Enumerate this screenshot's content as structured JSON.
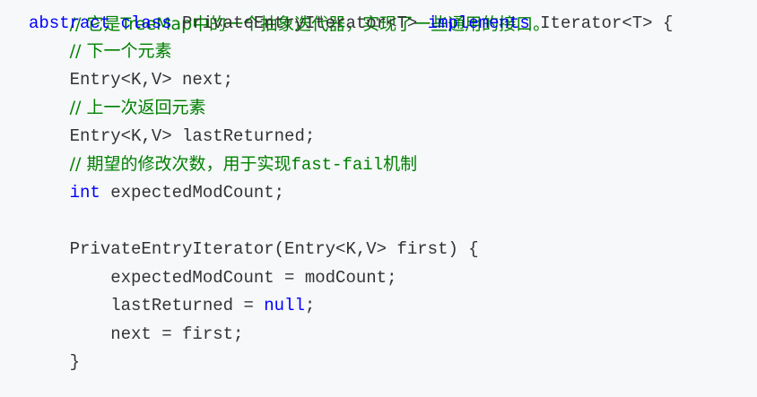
{
  "code": {
    "line0": {
      "comment": "// 它是TreeMap中的一个抽象迭代器，实现了一些通用的接口。"
    },
    "line1": {
      "kw_abstract": "abstract",
      "kw_class": "class",
      "name": "PrivateEntryIterator<T>",
      "kw_implements": "implements",
      "rest": "Iterator<T> {"
    },
    "line2": {
      "comment": "// 下一个元素"
    },
    "line3": {
      "text": "Entry<K,V> next;"
    },
    "line4": {
      "comment": "// 上一次返回元素"
    },
    "line5": {
      "text": "Entry<K,V> lastReturned;"
    },
    "line6": {
      "comment_prefix": "// 期望的修改次数，用于实现",
      "comment_code": "fast-fail",
      "comment_suffix": "机制"
    },
    "line7": {
      "kw_int": "int",
      "rest": "expectedModCount;"
    },
    "line9": {
      "text": "PrivateEntryIterator(Entry<K,V> first) {"
    },
    "line10": {
      "text": "expectedModCount = modCount;"
    },
    "line11": {
      "text": "lastReturned = ",
      "kw_null": "null",
      "semi": ";"
    },
    "line12": {
      "text": "next = first;"
    },
    "line13": {
      "text": "}"
    }
  }
}
